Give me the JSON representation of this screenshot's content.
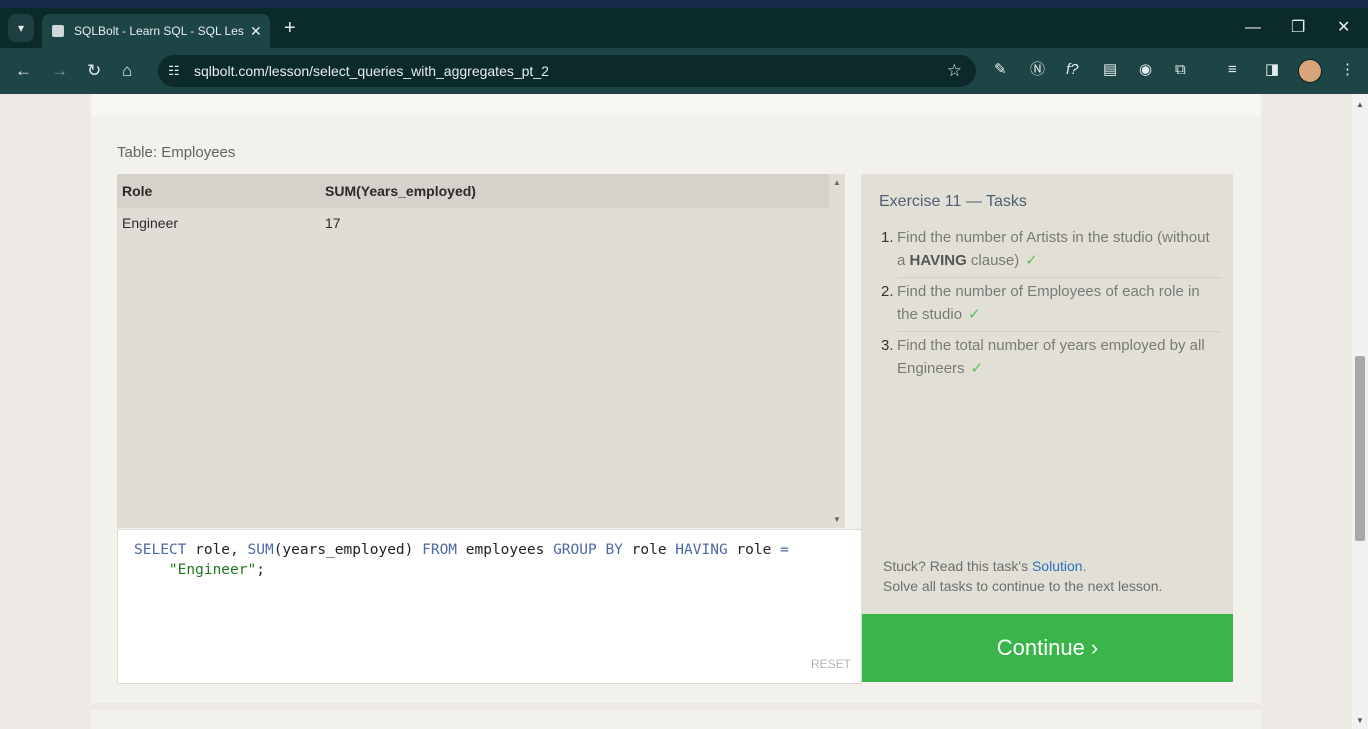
{
  "browser": {
    "tab_title": "SQLBolt - Learn SQL - SQL Lesson",
    "new_tab": "+",
    "url": "sqlbolt.com/lesson/select_queries_with_aggregates_pt_2",
    "window_controls": {
      "minimize": "—",
      "maximize": "❐",
      "close": "✕"
    }
  },
  "page": {
    "table_label": "Table: Employees",
    "results": {
      "headers": [
        "Role",
        "SUM(Years_employed)"
      ],
      "rows": [
        [
          "Engineer",
          "17"
        ]
      ]
    },
    "editor": {
      "line1": {
        "select": "SELECT",
        "a": " role, ",
        "sum": "SUM",
        "b": "(years_employed) ",
        "from": "FROM",
        "c": " employees ",
        "groupby": "GROUP BY",
        "d": " role ",
        "having": "HAVING",
        "e": " role ",
        "eq": "="
      },
      "line2": {
        "indent": "    ",
        "str": "\"Engineer\"",
        "end": ";"
      },
      "reset_label": "RESET"
    },
    "tasks": {
      "title": "Exercise 11 — Tasks",
      "items": [
        {
          "num": "1.",
          "text_a": "Find the number of Artists in the studio (without a ",
          "bold": "HAVING",
          "text_b": " clause)",
          "check": "✓"
        },
        {
          "num": "2.",
          "text": "Find the number of Employees of each role in the studio",
          "check": "✓"
        },
        {
          "num": "3.",
          "text": "Find the total number of years employed by all Engineers",
          "check": "✓"
        }
      ],
      "stuck_prefix": "Stuck? Read this task's ",
      "solution_link": "Solution",
      "stuck_suffix": ".",
      "solve_all": "Solve all tasks to continue to the next lesson."
    },
    "continue_label": "Continue ›"
  }
}
